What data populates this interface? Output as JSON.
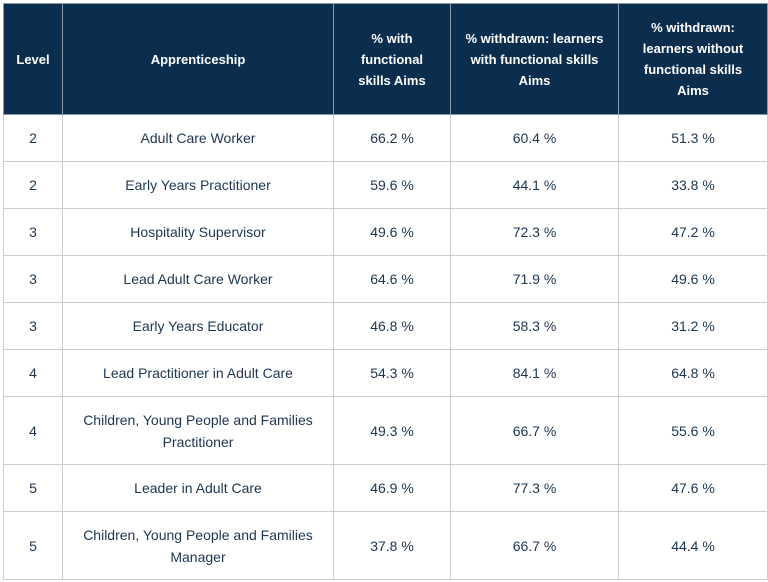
{
  "header": {
    "level": "Level",
    "apprenticeship": "Apprenticeship",
    "pct_with": "% with functional skills Aims",
    "withdrawn_with": "% withdrawn: learners with functional skills Aims",
    "withdrawn_without": "% withdrawn: learners without functional skills Aims"
  },
  "rows": [
    {
      "level": "2",
      "apprenticeship": "Adult Care Worker",
      "pct_with": "66.2 %",
      "withdrawn_with": "60.4 %",
      "withdrawn_without": "51.3 %"
    },
    {
      "level": "2",
      "apprenticeship": "Early Years Practitioner",
      "pct_with": "59.6 %",
      "withdrawn_with": "44.1 %",
      "withdrawn_without": "33.8 %"
    },
    {
      "level": "3",
      "apprenticeship": "Hospitality Supervisor",
      "pct_with": "49.6 %",
      "withdrawn_with": "72.3 %",
      "withdrawn_without": "47.2 %"
    },
    {
      "level": "3",
      "apprenticeship": "Lead Adult Care Worker",
      "pct_with": "64.6 %",
      "withdrawn_with": "71.9 %",
      "withdrawn_without": "49.6 %"
    },
    {
      "level": "3",
      "apprenticeship": "Early Years Educator",
      "pct_with": "46.8 %",
      "withdrawn_with": "58.3 %",
      "withdrawn_without": "31.2 %"
    },
    {
      "level": "4",
      "apprenticeship": "Lead Practitioner in Adult Care",
      "pct_with": "54.3 %",
      "withdrawn_with": "84.1 %",
      "withdrawn_without": "64.8 %"
    },
    {
      "level": "4",
      "apprenticeship": "Children, Young People and Families Practitioner",
      "pct_with": "49.3 %",
      "withdrawn_with": "66.7 %",
      "withdrawn_without": "55.6 %"
    },
    {
      "level": "5",
      "apprenticeship": "Leader in Adult Care",
      "pct_with": "46.9 %",
      "withdrawn_with": "77.3 %",
      "withdrawn_without": "47.6 %"
    },
    {
      "level": "5",
      "apprenticeship": "Children, Young People and Families Manager",
      "pct_with": "37.8 %",
      "withdrawn_with": "66.7 %",
      "withdrawn_without": "44.4 %"
    }
  ],
  "colors": {
    "header_bg": "#0b2e4e",
    "header_text": "#ffffff",
    "body_text": "#1d3550"
  }
}
